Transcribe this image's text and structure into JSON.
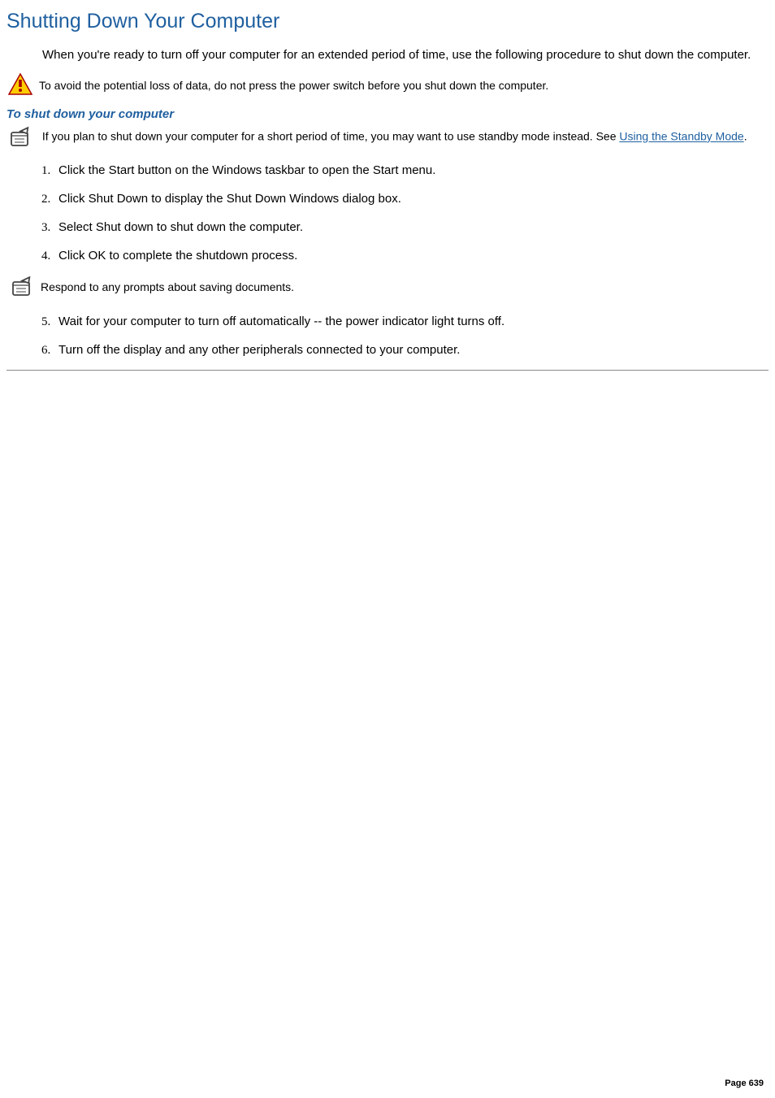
{
  "title": "Shutting Down Your Computer",
  "intro": "When you're ready to turn off your computer for an extended period of time, use the following procedure to shut down the computer.",
  "warning": "To avoid the potential loss of data, do not press the power switch before you shut down the computer.",
  "subheading": "To shut down your computer",
  "note1_part1": " If you plan to shut down your computer for a short period of time, you may want to use standby mode instead. See ",
  "note1_link": "Using the Standby Mode",
  "note1_part2": ".",
  "steps_a": [
    "Click the Start button on the Windows taskbar to open the Start menu.",
    "Click Shut Down to display the Shut Down Windows dialog box.",
    "Select Shut down to shut down the computer.",
    "Click OK to complete the shutdown process."
  ],
  "note2": "Respond to any prompts about saving documents.",
  "steps_b": [
    "Wait for your computer to turn off automatically -- the power indicator light turns off.",
    "Turn off the display and any other peripherals connected to your computer."
  ],
  "page_number": "Page 639"
}
